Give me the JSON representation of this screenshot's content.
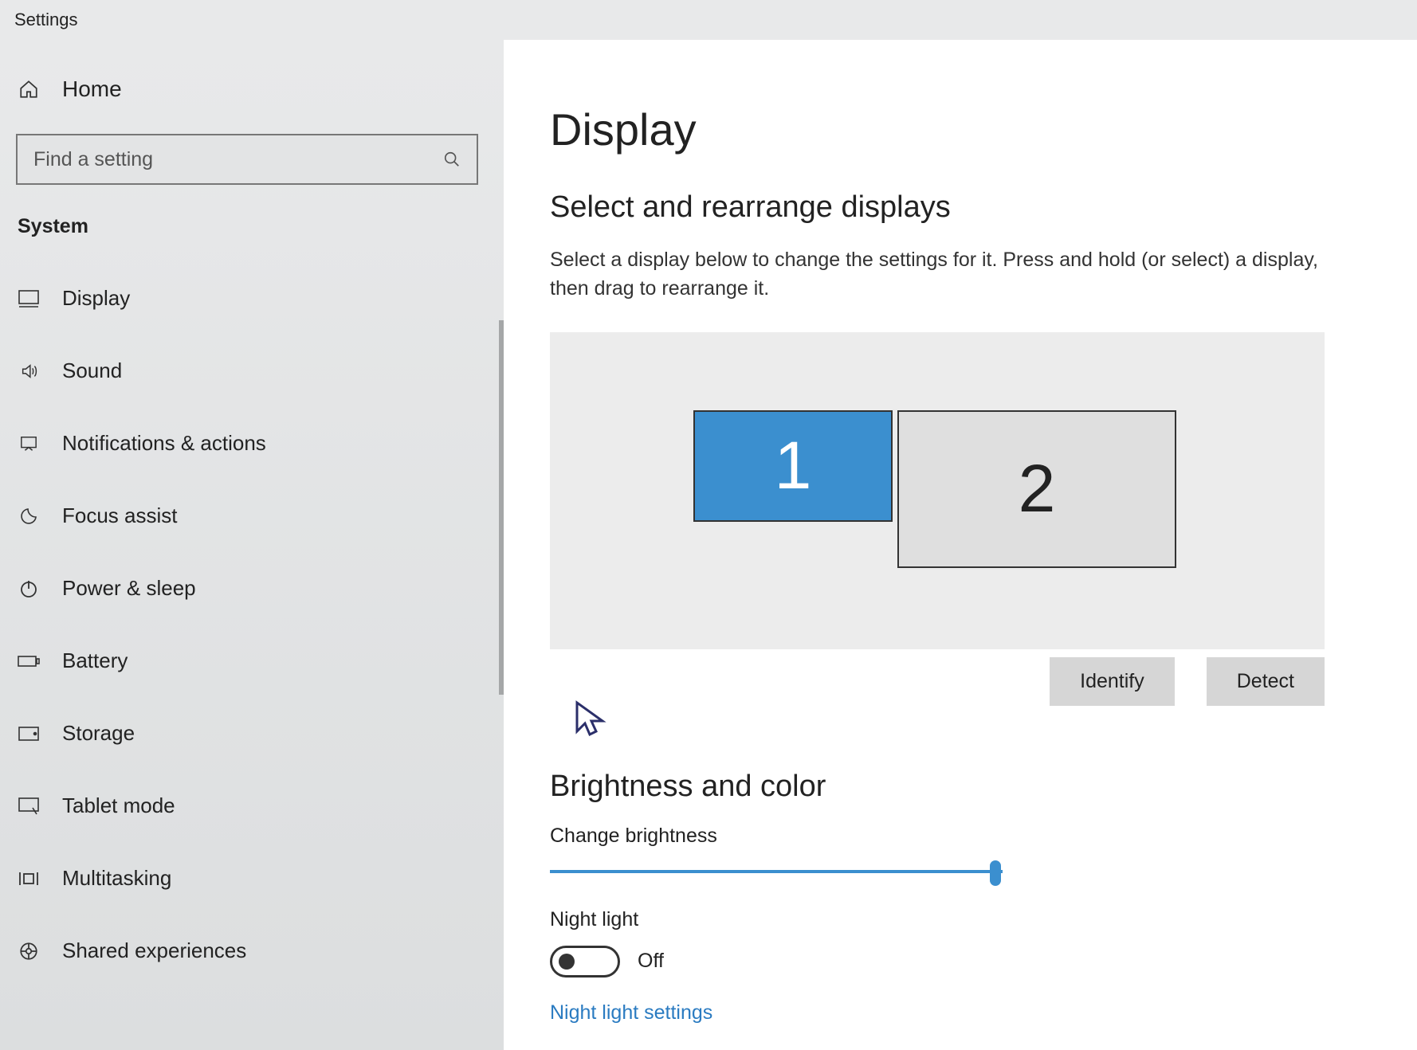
{
  "window": {
    "title": "Settings"
  },
  "sidebar": {
    "home": "Home",
    "search_placeholder": "Find a setting",
    "section": "System",
    "items": [
      {
        "label": "Display"
      },
      {
        "label": "Sound"
      },
      {
        "label": "Notifications & actions"
      },
      {
        "label": "Focus assist"
      },
      {
        "label": "Power & sleep"
      },
      {
        "label": "Battery"
      },
      {
        "label": "Storage"
      },
      {
        "label": "Tablet mode"
      },
      {
        "label": "Multitasking"
      },
      {
        "label": "Shared experiences"
      }
    ]
  },
  "main": {
    "title": "Display",
    "arrange": {
      "heading": "Select and rearrange displays",
      "desc": "Select a display below to change the settings for it. Press and hold (or select) a display, then drag to rearrange it.",
      "monitor1": "1",
      "monitor2": "2",
      "identify": "Identify",
      "detect": "Detect"
    },
    "brightness": {
      "heading": "Brightness and color",
      "change_label": "Change brightness",
      "night_label": "Night light",
      "night_state": "Off",
      "night_settings": "Night light settings"
    }
  }
}
